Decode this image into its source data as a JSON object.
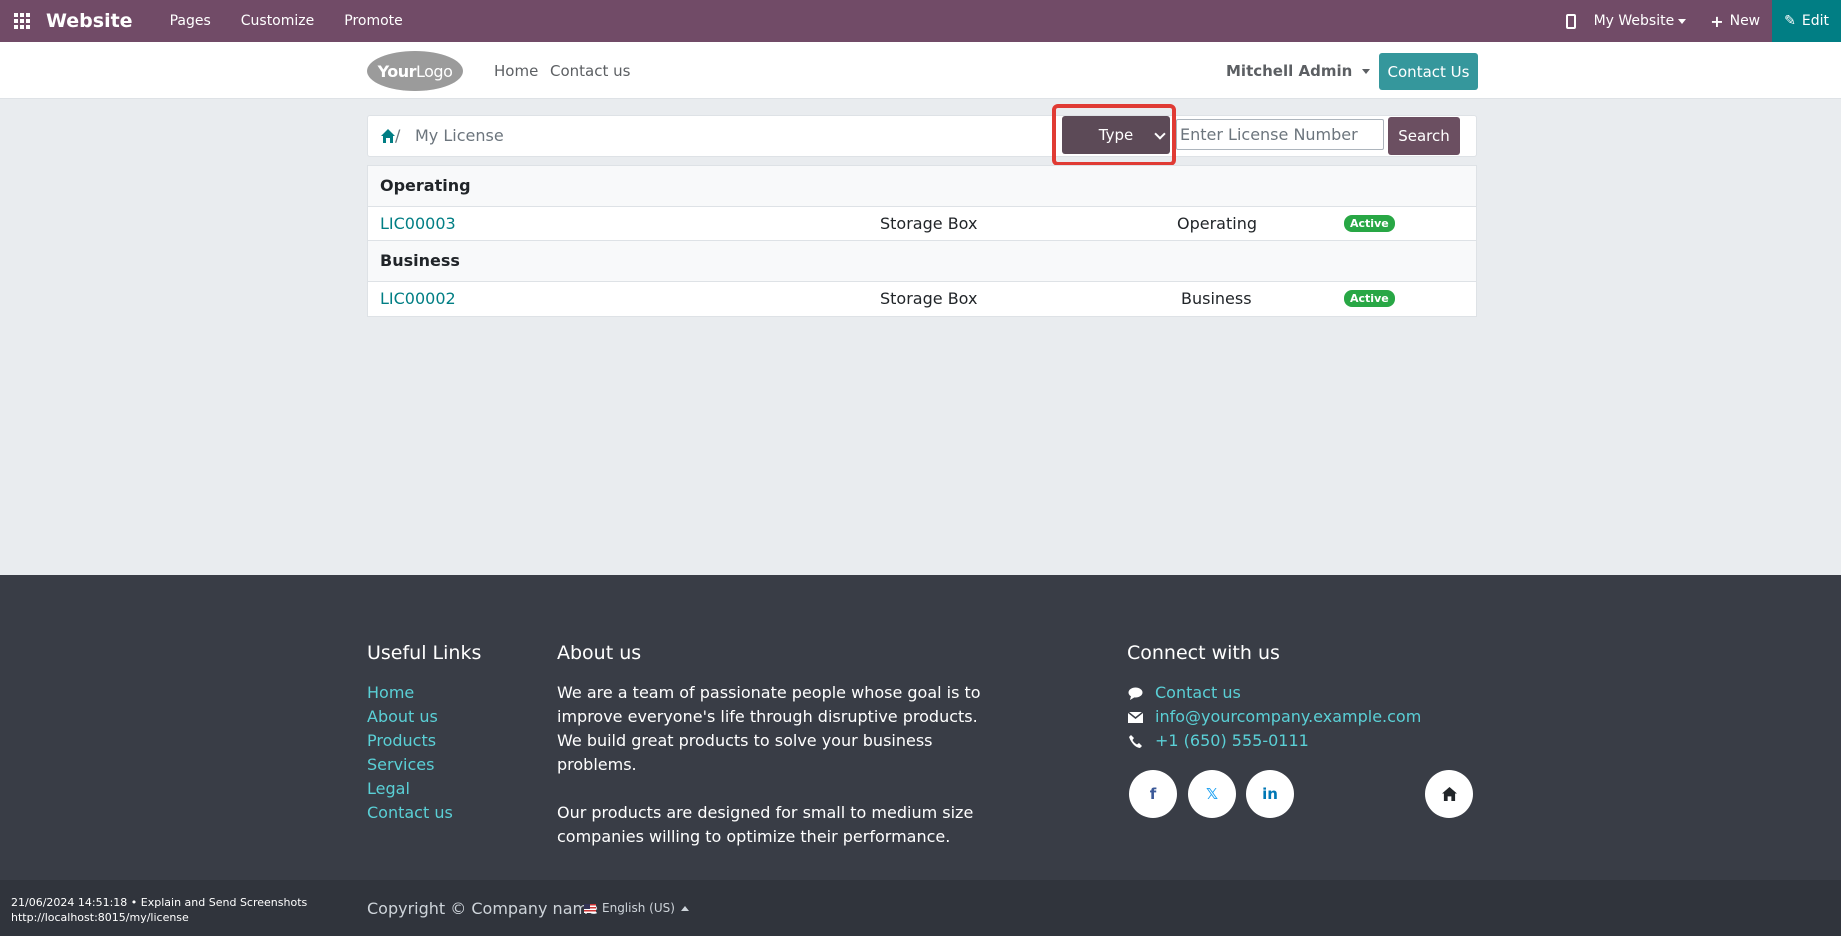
{
  "topbar": {
    "brand": "Website",
    "menus": [
      "Pages",
      "Customize",
      "Promote"
    ],
    "website_selector": "My Website",
    "new_label": "New",
    "edit_label": "Edit"
  },
  "header": {
    "logo_text_bold": "Your",
    "logo_text_thin": "Logo",
    "nav": [
      "Home",
      "Contact us"
    ],
    "user": "Mitchell Admin",
    "cta": "Contact Us"
  },
  "breadcrumb": {
    "separator": "/",
    "current": "My License"
  },
  "filter": {
    "type_label": "Type",
    "license_placeholder": "Enter License Number",
    "search_label": "Search"
  },
  "licenses": {
    "groups": [
      {
        "name": "Operating",
        "rows": [
          {
            "ref": "LIC00003",
            "product": "Storage Box",
            "type": "Operating",
            "status": "Active"
          }
        ]
      },
      {
        "name": "Business",
        "rows": [
          {
            "ref": "LIC00002",
            "product": "Storage Box",
            "type": "Business",
            "status": "Active"
          }
        ]
      }
    ]
  },
  "footer": {
    "useful_links_title": "Useful Links",
    "useful_links": [
      "Home",
      "About us",
      "Products",
      "Services",
      "Legal",
      "Contact us"
    ],
    "about_title": "About us",
    "about_p1": "We are a team of passionate people whose goal is to improve everyone's life through disruptive products. We build great products to solve your business problems.",
    "about_p2": "Our products are designed for small to medium size companies willing to optimize their performance.",
    "connect_title": "Connect with us",
    "contact_link": "Contact us",
    "email": "info@yourcompany.example.com",
    "phone": "+1 (650) 555-0111",
    "social": [
      "f",
      "𝕏",
      "in"
    ]
  },
  "copyright": {
    "text": "Copyright © Company name",
    "language": "English (US)",
    "stamp_line1": "21/06/2024 14:51:18 • Explain and Send Screenshots",
    "stamp_line2": "http://localhost:8015/my/license"
  },
  "colors": {
    "admin_bar": "#714b67",
    "accent": "#017e84",
    "badge_success": "#28a745",
    "highlight": "#e03b34"
  }
}
